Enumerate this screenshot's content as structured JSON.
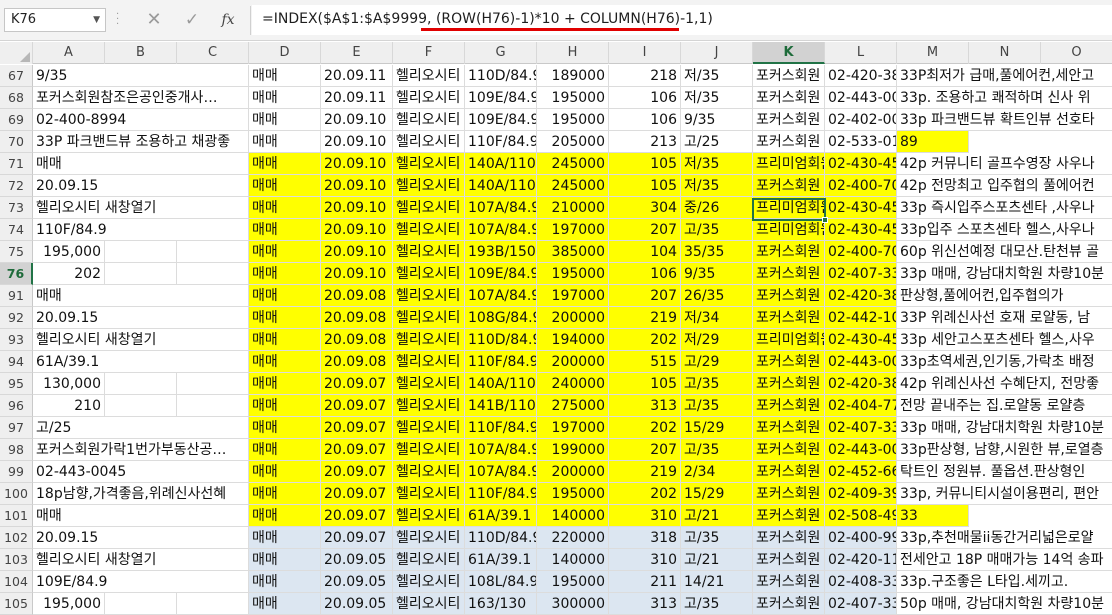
{
  "name_box": "K76",
  "formula_bar": {
    "fx_label": "fx",
    "formula": "=INDEX($A$1:$A$9999, (ROW(H76)-1)*10 + COLUMN(H76)-1,1)"
  },
  "columns": [
    "A",
    "B",
    "C",
    "D",
    "E",
    "F",
    "G",
    "H",
    "I",
    "J",
    "K",
    "L",
    "M",
    "N",
    "O"
  ],
  "selected_column": "K",
  "selected_row": "76",
  "colors": {
    "highlight_yellow": "#ffff00",
    "highlight_blue": "#dce6f1",
    "selection_green": "#217346"
  },
  "rows": [
    {
      "num": "67",
      "fill": "none",
      "a": "9/35",
      "a_align": "left",
      "cells": [
        "매매",
        "20.09.11",
        "헬리오시티",
        "110D/84.9",
        "189000",
        "218",
        "저/35",
        "포커스회원",
        "02-420-38",
        "33P최저가 급매,풀에어컨,세안고"
      ]
    },
    {
      "num": "68",
      "fill": "none",
      "a": "포커스회원참조은공인중개사…",
      "a_align": "left",
      "cells": [
        "매매",
        "20.09.11",
        "헬리오시티",
        "109E/84.9",
        "195000",
        "106",
        "저/35",
        "포커스회원",
        "02-443-00",
        "33p. 조용하고 쾌적하며 신사 위"
      ]
    },
    {
      "num": "69",
      "fill": "none",
      "a": "02-400-8994",
      "a_align": "left",
      "cells": [
        "매매",
        "20.09.10",
        "헬리오시티",
        "109E/84.9",
        "195000",
        "106",
        "9/35",
        "포커스회원",
        "02-402-00",
        "33p 파크밴드뷰 확트인뷰 선호타"
      ]
    },
    {
      "num": "70",
      "fill": "none",
      "a": "33P 파크밴드뷰 조용하고 채광좋",
      "a_align": "left",
      "cells": [
        "매매",
        "20.09.10",
        "헬리오시티",
        "110F/84.9",
        "205000",
        "213",
        "고/25",
        "포커스회원",
        "02-533-01",
        "89"
      ]
    },
    {
      "num": "71",
      "fill": "yellow",
      "a": "매매",
      "a_align": "left",
      "cells": [
        "매매",
        "20.09.10",
        "헬리오시티",
        "140A/110.0",
        "245000",
        "105",
        "저/35",
        "프리미엄회원",
        "02-430-45",
        "42p 커뮤니티 골프수영장 사우나"
      ]
    },
    {
      "num": "72",
      "fill": "yellow",
      "a": "20.09.15",
      "a_align": "left",
      "cells": [
        "매매",
        "20.09.10",
        "헬리오시티",
        "140A/110.0",
        "245000",
        "105",
        "저/35",
        "포커스회원",
        "02-400-70",
        "42p 전망최고 입주협의 풀에어컨"
      ]
    },
    {
      "num": "73",
      "fill": "yellow",
      "a": "헬리오시티 새창열기",
      "a_align": "left",
      "cells": [
        "매매",
        "20.09.10",
        "헬리오시티",
        "107A/84.9",
        "210000",
        "304",
        "중/26",
        "프리미엄회원",
        "02-430-45",
        "33p 즉시입주스포츠센타 ,사우나"
      ]
    },
    {
      "num": "74",
      "fill": "yellow",
      "a": "110F/84.9",
      "a_align": "left",
      "cells": [
        "매매",
        "20.09.10",
        "헬리오시티",
        "107A/84.9",
        "197000",
        "207",
        "고/35",
        "프리미엄회원",
        "02-430-45",
        "33p입주 스포츠센타 헬스,사우나"
      ]
    },
    {
      "num": "75",
      "fill": "yellow",
      "a": "195,000",
      "a_align": "right",
      "cells": [
        "매매",
        "20.09.10",
        "헬리오시티",
        "193B/150",
        "385000",
        "104",
        "35/35",
        "포커스회원",
        "02-400-70",
        "60p 위신선예정 대모산.탄천뷰 골"
      ]
    },
    {
      "num": "76",
      "fill": "yellow",
      "a": "202",
      "a_align": "right",
      "cells": [
        "매매",
        "20.09.10",
        "헬리오시티",
        "109E/84.9",
        "195000",
        "106",
        "9/35",
        "포커스회원",
        "02-407-33",
        "33p 매매, 강남대치학원 차량10분"
      ]
    },
    {
      "num": "91",
      "fill": "yellow",
      "a": "매매",
      "a_align": "left",
      "cells": [
        "매매",
        "20.09.08",
        "헬리오시티",
        "107A/84.9",
        "197000",
        "207",
        "26/35",
        "포커스회원",
        "02-420-38",
        "판상형,풀에어컨,입주협의가"
      ]
    },
    {
      "num": "92",
      "fill": "yellow",
      "a": "20.09.15",
      "a_align": "left",
      "cells": [
        "매매",
        "20.09.08",
        "헬리오시티",
        "108G/84.9",
        "200000",
        "219",
        "저/34",
        "포커스회원",
        "02-442-10",
        "33P 위례신사선 호재 로얄동, 남"
      ]
    },
    {
      "num": "93",
      "fill": "yellow",
      "a": "헬리오시티 새창열기",
      "a_align": "left",
      "cells": [
        "매매",
        "20.09.08",
        "헬리오시티",
        "110D/84.9",
        "194000",
        "202",
        "저/29",
        "프리미엄회원",
        "02-430-45",
        "33p 세안고스포츠센타 헬스,사우"
      ]
    },
    {
      "num": "94",
      "fill": "yellow",
      "a": "61A/39.1",
      "a_align": "left",
      "cells": [
        "매매",
        "20.09.08",
        "헬리오시티",
        "110F/84.9",
        "200000",
        "515",
        "고/29",
        "포커스회원",
        "02-443-00",
        "33p초역세권,인기동,가락초 배정"
      ]
    },
    {
      "num": "95",
      "fill": "yellow",
      "a": "130,000",
      "a_align": "right",
      "cells": [
        "매매",
        "20.09.07",
        "헬리오시티",
        "140A/110.0",
        "240000",
        "105",
        "고/35",
        "포커스회원",
        "02-420-38",
        "42p 위례신사선 수혜단지, 전망좋"
      ]
    },
    {
      "num": "96",
      "fill": "yellow",
      "a": "210",
      "a_align": "right",
      "cells": [
        "매매",
        "20.09.07",
        "헬리오시티",
        "141B/110.4",
        "275000",
        "313",
        "고/35",
        "포커스회원",
        "02-404-77",
        "전망 끝내주는 집.로얄동 로얄층"
      ]
    },
    {
      "num": "97",
      "fill": "yellow",
      "a": "고/25",
      "a_align": "left",
      "cells": [
        "매매",
        "20.09.07",
        "헬리오시티",
        "110F/84.9",
        "197000",
        "202",
        "15/29",
        "포커스회원",
        "02-407-33",
        "33p 매매, 강남대치학원 차량10분"
      ]
    },
    {
      "num": "98",
      "fill": "yellow",
      "a": "포커스회원가락1번가부동산공…",
      "a_align": "left",
      "cells": [
        "매매",
        "20.09.07",
        "헬리오시티",
        "107A/84.9",
        "199000",
        "207",
        "고/35",
        "포커스회원",
        "02-443-00",
        "33p판상형, 남향,시원한 뷰,로열층"
      ]
    },
    {
      "num": "99",
      "fill": "yellow",
      "a": "02-443-0045",
      "a_align": "left",
      "cells": [
        "매매",
        "20.09.07",
        "헬리오시티",
        "107A/84.9",
        "200000",
        "219",
        "2/34",
        "포커스회원",
        "02-452-66",
        "탁트인 정원뷰. 풀옵션.판상형인"
      ]
    },
    {
      "num": "100",
      "fill": "yellow",
      "a": "18p남향,가격좋음,위례신사선혜",
      "a_align": "left",
      "cells": [
        "매매",
        "20.09.07",
        "헬리오시티",
        "110F/84.9",
        "195000",
        "202",
        "15/29",
        "포커스회원",
        "02-409-39",
        "33p, 커뮤니티시설이용편리, 편안"
      ]
    },
    {
      "num": "101",
      "fill": "yellow",
      "a": "매매",
      "a_align": "left",
      "cells": [
        "매매",
        "20.09.07",
        "헬리오시티",
        "61A/39.1",
        "140000",
        "310",
        "고/21",
        "포커스회원",
        "02-508-49",
        "33"
      ]
    },
    {
      "num": "102",
      "fill": "blue",
      "a": "20.09.15",
      "a_align": "left",
      "cells": [
        "매매",
        "20.09.07",
        "헬리오시티",
        "110D/84.9",
        "220000",
        "318",
        "고/35",
        "포커스회원",
        "02-400-99",
        "33p,추천매물ii동간거리넓은로얄"
      ]
    },
    {
      "num": "103",
      "fill": "blue",
      "a": "헬리오시티 새창열기",
      "a_align": "left",
      "cells": [
        "매매",
        "20.09.05",
        "헬리오시티",
        "61A/39.1",
        "140000",
        "310",
        "고/21",
        "포커스회원",
        "02-420-11",
        "전세안고 18P 매매가능 14억 송파"
      ]
    },
    {
      "num": "104",
      "fill": "blue",
      "a": "109E/84.9",
      "a_align": "left",
      "cells": [
        "매매",
        "20.09.05",
        "헬리오시티",
        "108L/84.9",
        "195000",
        "211",
        "14/21",
        "포커스회원",
        "02-408-33",
        "33p.구조좋은 L타입.세끼고."
      ]
    },
    {
      "num": "105",
      "fill": "blue",
      "a": "195,000",
      "a_align": "right",
      "cells": [
        "매매",
        "20.09.05",
        "헬리오시티",
        "163/130",
        "300000",
        "313",
        "고/35",
        "포커스회원",
        "02-407-33",
        "50p 매매, 강남대치학원 차량10분"
      ]
    }
  ]
}
